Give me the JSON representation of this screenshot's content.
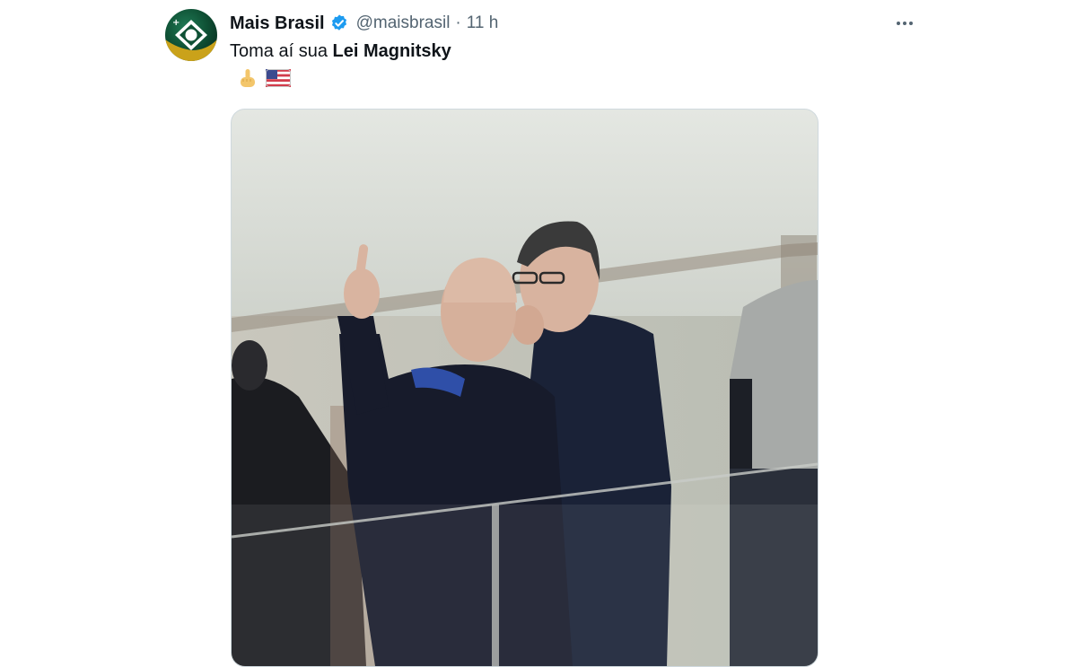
{
  "tweet": {
    "display_name": "Mais Brasil",
    "handle": "@maisbrasil",
    "separator": "·",
    "time": "11 h",
    "text_plain": "Toma aí sua ",
    "text_bold": "Lei Magnitsky",
    "emojis": [
      "middle-finger-emoji",
      "us-flag-emoji"
    ]
  },
  "icons": {
    "verified": "verified-badge-icon",
    "more": "more-options-icon",
    "avatar": "mais-brasil-logo"
  },
  "colors": {
    "verified_blue": "#1d9bf0",
    "text_primary": "#0f1419",
    "text_secondary": "#536471",
    "avatar_green": "#0f5135",
    "avatar_yellow": "#f0c419"
  }
}
